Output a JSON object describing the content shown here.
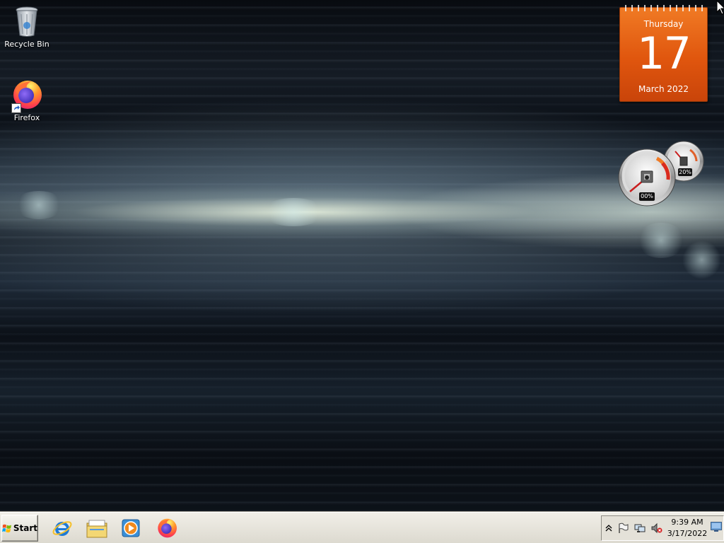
{
  "desktop": {
    "icons": [
      {
        "label": "Recycle Bin",
        "icon": "recycle-bin-icon"
      },
      {
        "label": "Firefox",
        "icon": "firefox-icon"
      }
    ]
  },
  "calendar_gadget": {
    "weekday": "Thursday",
    "day": "17",
    "month_year": "March 2022",
    "color": "#e0560e"
  },
  "meter_gadget": {
    "cpu_label": "00%",
    "memory_label": "20%",
    "cpu_percent": 0,
    "memory_percent": 20
  },
  "taskbar": {
    "start_label": "Start",
    "pinned": [
      {
        "name": "internet-explorer",
        "icon": "internet-explorer-icon"
      },
      {
        "name": "windows-explorer",
        "icon": "folder-icon"
      },
      {
        "name": "windows-media-player",
        "icon": "media-player-icon"
      },
      {
        "name": "firefox",
        "icon": "firefox-icon"
      }
    ],
    "tray": {
      "icons": [
        "show-hidden-icons-chevron",
        "action-center-flag-icon",
        "network-icon",
        "volume-muted-icon"
      ],
      "time": "9:39 AM",
      "date": "3/17/2022"
    }
  }
}
